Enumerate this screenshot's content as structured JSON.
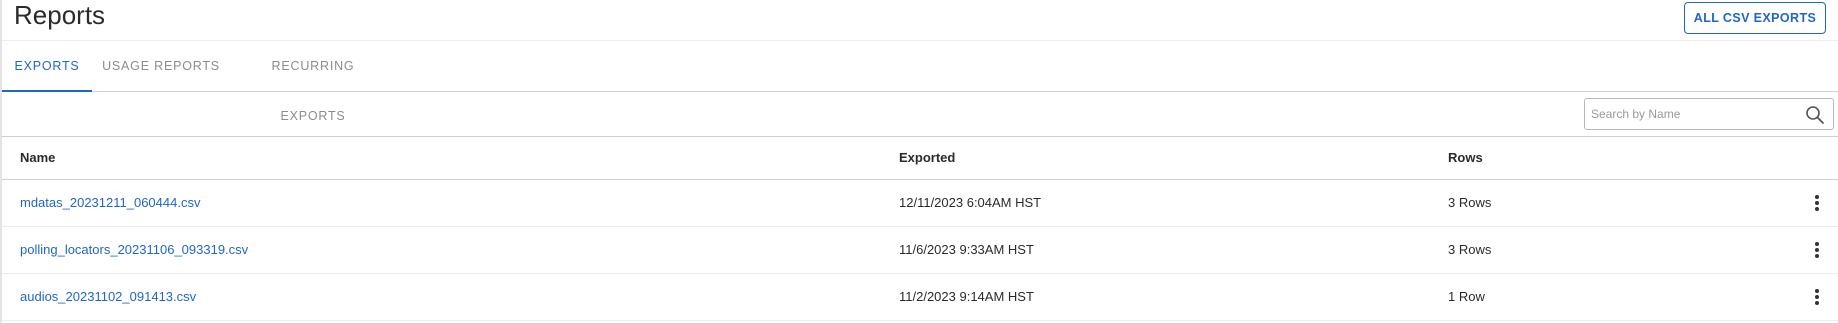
{
  "header": {
    "title": "Reports",
    "export_button_label": "ALL CSV EXPORTS"
  },
  "tabs": [
    {
      "label": "EXPORTS",
      "active": true
    },
    {
      "label": "USAGE REPORTS",
      "active": false
    },
    {
      "label": "RECURRING EXPORTS",
      "active": false
    }
  ],
  "search": {
    "placeholder": "Search by Name",
    "value": "",
    "icon": "search-icon"
  },
  "table": {
    "columns": [
      "Name",
      "Exported",
      "Rows"
    ],
    "rows": [
      {
        "name": "mdatas_20231211_060444.csv",
        "exported": "12/11/2023 6:04AM HST",
        "rows": "3 Rows"
      },
      {
        "name": "polling_locators_20231106_093319.csv",
        "exported": "11/6/2023 9:33AM HST",
        "rows": "3 Rows"
      },
      {
        "name": "audios_20231102_091413.csv",
        "exported": "11/2/2023 9:14AM HST",
        "rows": "1 Row"
      }
    ],
    "row_menu_icon": "kebab-menu-icon"
  },
  "colors": {
    "accent": "#1f66c9",
    "inactive_tab": "#8c8c8c",
    "border": "#cfcfcf"
  }
}
